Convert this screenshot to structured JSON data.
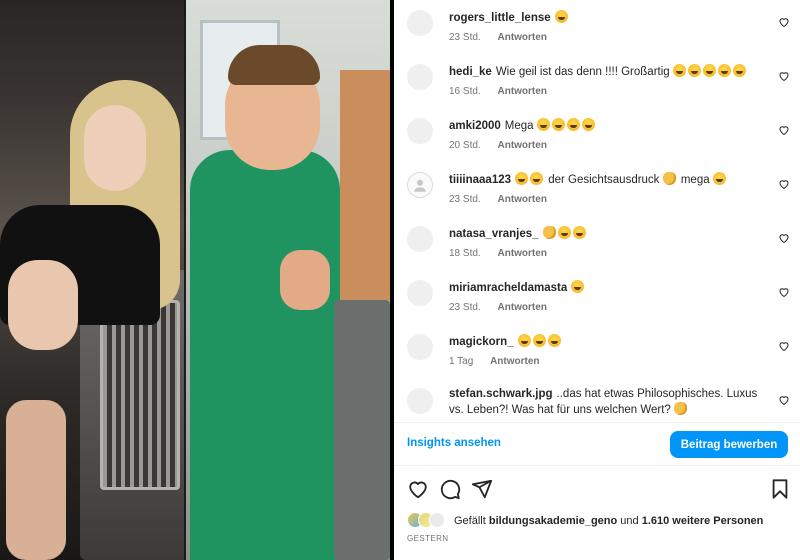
{
  "comments": [
    {
      "user": "rogers_little_lense",
      "text": "",
      "emojis": [
        "laugh"
      ],
      "time": "23 Std.",
      "reply": "Antworten"
    },
    {
      "user": "hedi_ke",
      "text": "Wie geil ist das denn !!!! Großartig",
      "emojis": [
        "laugh",
        "laugh",
        "laugh",
        "laugh",
        "laugh"
      ],
      "time": "16 Std.",
      "reply": "Antworten"
    },
    {
      "user": "amki2000",
      "text": "Mega",
      "emojis": [
        "laugh",
        "laugh",
        "laugh",
        "laugh"
      ],
      "time": "20 Std.",
      "reply": "Antworten"
    },
    {
      "user": "tiiiinaaa123",
      "text_before": "",
      "text_mid": "der Gesichtsausdruck",
      "text_after": "mega",
      "time": "23 Std.",
      "reply": "Antworten"
    },
    {
      "user": "natasa_vranjes_",
      "text": "",
      "time": "18 Std.",
      "reply": "Antworten"
    },
    {
      "user": "miriamracheldamasta",
      "text": "",
      "time": "23 Std.",
      "reply": "Antworten"
    },
    {
      "user": "magickorn_",
      "text": "",
      "time": "1 Tag",
      "reply": "Antworten"
    },
    {
      "user": "stefan.schwark.jpg",
      "text": "..das hat etwas Philosophisches. Luxus vs. Leben?! Was hat für uns welchen Wert?"
    }
  ],
  "actions": {
    "insights": "Insights ansehen",
    "promote": "Beitrag bewerben"
  },
  "likes": {
    "prefix": "Gefällt",
    "user": "bildungsakademie_geno",
    "middle": "und",
    "count": "1.610 weitere Personen"
  },
  "posted": "GESTERN",
  "icons": [
    "heart-icon",
    "comment-icon",
    "share-icon",
    "bookmark-icon"
  ],
  "colors": {
    "accent": "#0095f6",
    "meta": "#737373"
  }
}
